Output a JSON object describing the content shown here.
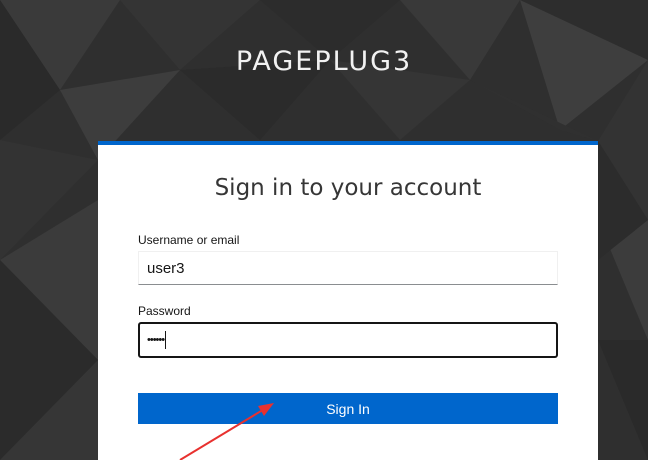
{
  "brand": "PAGEPLUG3",
  "form": {
    "title": "Sign in to your account",
    "username_label": "Username or email",
    "username_value": "user3",
    "password_label": "Password",
    "password_masked": "••••••",
    "submit_label": "Sign In"
  },
  "colors": {
    "accent": "#0066cc",
    "background": "#2e2e2e",
    "annotation_arrow": "#e8312f"
  },
  "icons": [
    "annotation-arrow"
  ]
}
